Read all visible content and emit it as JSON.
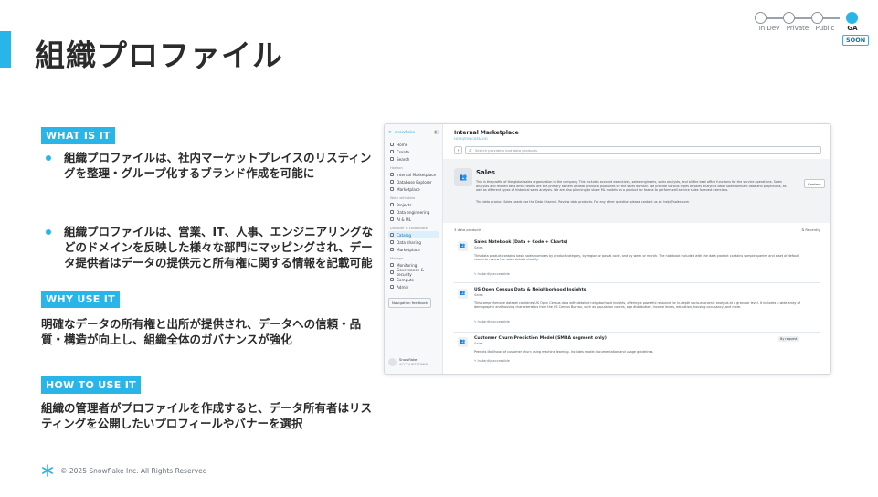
{
  "slide": {
    "title": "組織プロファイル",
    "stages": [
      {
        "label": "In Dev",
        "active": false
      },
      {
        "label": "Private",
        "active": false
      },
      {
        "label": "Public",
        "active": false
      },
      {
        "label": "GA",
        "active": true
      }
    ],
    "soon": "SOON",
    "what_label": "WHAT IS IT",
    "what_bullets": [
      "組織プロファイルは、社内マーケットプレイスのリスティングを整理・グループ化するブランド作成を可能に",
      "組織プロファイルは、営業、IT、人事、エンジニアリングなどのドメインを反映した様々な部門にマッピングされ、データ提供者はデータの提供元と所有権に関する情報を記載可能"
    ],
    "why_label": "WHY USE IT",
    "why_text": "明確なデータの所有権と出所が提供され、データへの信頼・品質・構造が向上し、組織全体のガバナンスが強化",
    "how_label": "HOW TO USE IT",
    "how_text": "組織の管理者がプロファイルを作成すると、データ所有者はリスティングを公開したいプロフィールやバナーを選択",
    "footer": "© 2025 Snowflake Inc. All Rights Reserved",
    "accent_color": "#29b5e8"
  },
  "app": {
    "brand": "snowflake",
    "nav_top": [
      "Home",
      "Create",
      "Search"
    ],
    "groups": [
      {
        "label": "Horizon",
        "items": [
          "Internal Marketplace",
          "Database Explorer",
          "Marketplace"
        ]
      },
      {
        "label": "Work with data",
        "items": [
          "Projects",
          "Data engineering",
          "AI & ML"
        ]
      },
      {
        "label": "Discover & collaborate",
        "items": [
          "Catalog",
          "Data sharing",
          "Marketplace"
        ]
      },
      {
        "label": "Manage",
        "items": [
          "Monitoring",
          "Governance & security",
          "Compute",
          "Admin"
        ]
      }
    ],
    "selected_item": "Catalog",
    "nav_button": "Navigation feedback",
    "user_name": "Snowflake",
    "user_role": "ACCOUNTADMIN",
    "marketplace_title": "Internal Marketplace",
    "marketplace_sub": "HORIZON CATALOG",
    "search_placeholder": "Search providers and data products",
    "profile_name": "Sales",
    "profile_desc": "This is the profile of the global sales organization in the company. This includes account executives, sales engineers, sales analysts, and all the best office functions for the service operations. Sales analysts and related best office teams are the primary owners of data products published by the sales domain. We provide various types of sales analytics data, sales forecast data and projections, as well as different types of historical sales analysis. We are also planning to share ML models as a product for teams to perform self-service sales forecast exercises.",
    "profile_note": "The data product Sales Leads use the Data Channel. Review data products. For any other question please contact us at: help@sales.com",
    "contact_label": "Contact",
    "products_count": "3 data products",
    "recency_label": "Recently",
    "products": [
      {
        "name": "Sales Notebook (Data + Code + Charts)",
        "category": "Sales",
        "desc": "This data product contains basic sales numbers by product category, by region or postal code, and by week or month. The notebook included with the data product contains sample queries and a set of default charts to review the sales details visually.",
        "access": "Instantly accessible",
        "request": ""
      },
      {
        "name": "US Open Census Data & Neighborhood Insights",
        "category": "Sales",
        "desc": "This comprehensive dataset combines US Open Census data with detailed neighborhood insights, offering a powerful resource for in-depth socio-economic analysis at a granular level. It includes a wide array of demographic and housing characteristics from the US Census Bureau, such as population counts, age distribution, income levels, education, housing occupancy, and more.",
        "access": "Instantly accessible",
        "request": ""
      },
      {
        "name": "Customer Churn Prediction Model (SMBA segment only)",
        "category": "Sales",
        "desc": "Predicts likelihood of customer churn using machine learning. Includes model documentation and usage guidelines.",
        "access": "Instantly accessible",
        "request": "By request"
      }
    ]
  }
}
